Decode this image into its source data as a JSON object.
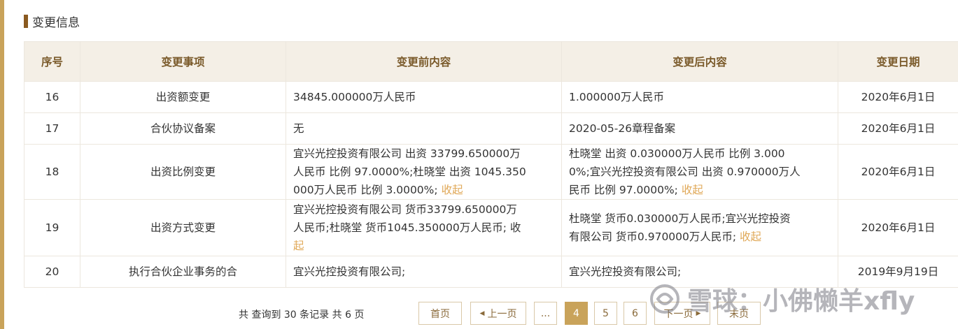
{
  "section": {
    "title": "变更信息"
  },
  "table": {
    "headers": [
      "序号",
      "变更事项",
      "变更前内容",
      "变更后内容",
      "变更日期"
    ],
    "rows": [
      {
        "no": "16",
        "item": "出资额变更",
        "before": "34845.000000万人民币",
        "after": "1.000000万人民币",
        "date": "2020年6月1日"
      },
      {
        "no": "17",
        "item": "合伙协议备案",
        "before": "无",
        "after": "2020-05-26章程备案",
        "date": "2020年6月1日"
      },
      {
        "no": "18",
        "item": "出资比例变更",
        "before_lines": [
          "宜兴光控投资有限公司 出资 33799.650000万",
          "人民币 比例 97.0000%;杜晓堂 出资 1045.350",
          "000万人民币 比例 3.0000%; "
        ],
        "after_lines": [
          "杜晓堂 出资 0.030000万人民币 比例 3.000",
          "0%;宜兴光控投资有限公司 出资 0.970000万人",
          "民币 比例 97.0000%; "
        ],
        "date": "2020年6月1日"
      },
      {
        "no": "19",
        "item": "出资方式变更",
        "before_lines": [
          "宜兴光控投资有限公司 货币33799.650000万",
          "人民币;杜晓堂 货币1045.350000万人民币; 收",
          ""
        ],
        "after_lines": [
          "杜晓堂 货币0.030000万人民币;宜兴光控投资",
          "有限公司 货币0.970000万人民币; "
        ],
        "date": "2020年6月1日"
      },
      {
        "no": "20",
        "item": "执行合伙企业事务的合",
        "before": "宜兴光控投资有限公司;",
        "after": "宜兴光控投资有限公司;",
        "date": "2019年9月19日"
      }
    ],
    "collapse_label": "收起",
    "collapse_label_tail": "起"
  },
  "pager": {
    "summary": "共 查询到 30 条记录 共 6 页",
    "first": "首页",
    "prev": "上一页",
    "ellipsis": "...",
    "pages": [
      "4",
      "5",
      "6"
    ],
    "next": "下一页",
    "last": "末页",
    "active_page": "4"
  },
  "watermark": {
    "text": "雪球：小佛懒羊xfly"
  },
  "colors": {
    "accent": "#c9a35a",
    "header_bg": "#f4efe6",
    "link": "#e0a857"
  }
}
